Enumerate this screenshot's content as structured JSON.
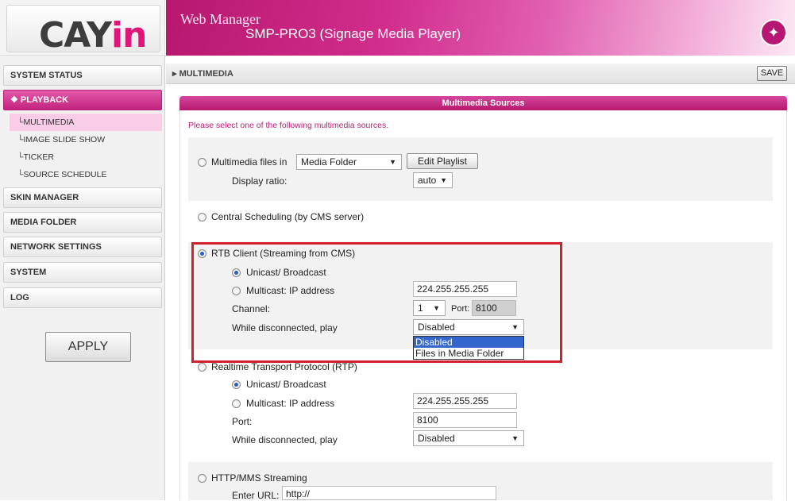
{
  "brand": {
    "logo_main": "CAY",
    "logo_accent": "in"
  },
  "header": {
    "title": "Web Manager",
    "product": "SMP-PRO3 (Signage Media Player)",
    "magic_icon": "wand-icon"
  },
  "breadcrumb": {
    "text": "▸ MULTIMEDIA"
  },
  "toolbar": {
    "save_label": "SAVE"
  },
  "sidebar": {
    "items": [
      {
        "label": "SYSTEM STATUS"
      },
      {
        "label": "❖ PLAYBACK"
      },
      {
        "label": "SKIN MANAGER"
      },
      {
        "label": "MEDIA FOLDER"
      },
      {
        "label": "NETWORK SETTINGS"
      },
      {
        "label": "SYSTEM"
      },
      {
        "label": "LOG"
      }
    ],
    "sub_items": [
      {
        "label": "└MULTIMEDIA"
      },
      {
        "label": "└IMAGE SLIDE SHOW"
      },
      {
        "label": "└TICKER"
      },
      {
        "label": "└SOURCE SCHEDULE"
      }
    ],
    "apply_label": "APPLY"
  },
  "panel": {
    "title": "Multimedia Sources",
    "intro": "Please select one of the following multimedia sources.",
    "files": {
      "label": "Multimedia files in",
      "folder_value": "Media Folder",
      "edit_label": "Edit Playlist",
      "ratio_label": "Display ratio:",
      "ratio_value": "auto"
    },
    "central": {
      "label": "Central Scheduling (by CMS server)"
    },
    "rtb": {
      "label": "RTB Client (Streaming from CMS)",
      "unicast_label": "Unicast/ Broadcast",
      "multicast_label": "Multicast: IP address",
      "multicast_ip": "224.255.255.255",
      "channel_label": "Channel:",
      "channel_value": "1",
      "port_label": "Port:",
      "port_value": "8100",
      "disconnect_label": "While disconnected, play",
      "disconnect_value": "Disabled",
      "options": [
        "Disabled",
        "Files in Media Folder"
      ]
    },
    "rtp": {
      "label": "Realtime Transport Protocol (RTP)",
      "unicast_label": "Unicast/ Broadcast",
      "multicast_label": "Multicast: IP address",
      "multicast_ip": "224.255.255.255",
      "port_label": "Port:",
      "port_value": "8100",
      "disconnect_label": "While disconnected, play",
      "disconnect_value": "Disabled"
    },
    "http": {
      "label": "HTTP/MMS Streaming",
      "url_label": "Enter URL:",
      "url_value": "http://"
    }
  },
  "colors": {
    "accent": "#c01a75",
    "highlight": "#d0222a",
    "selection": "#3366cc"
  }
}
